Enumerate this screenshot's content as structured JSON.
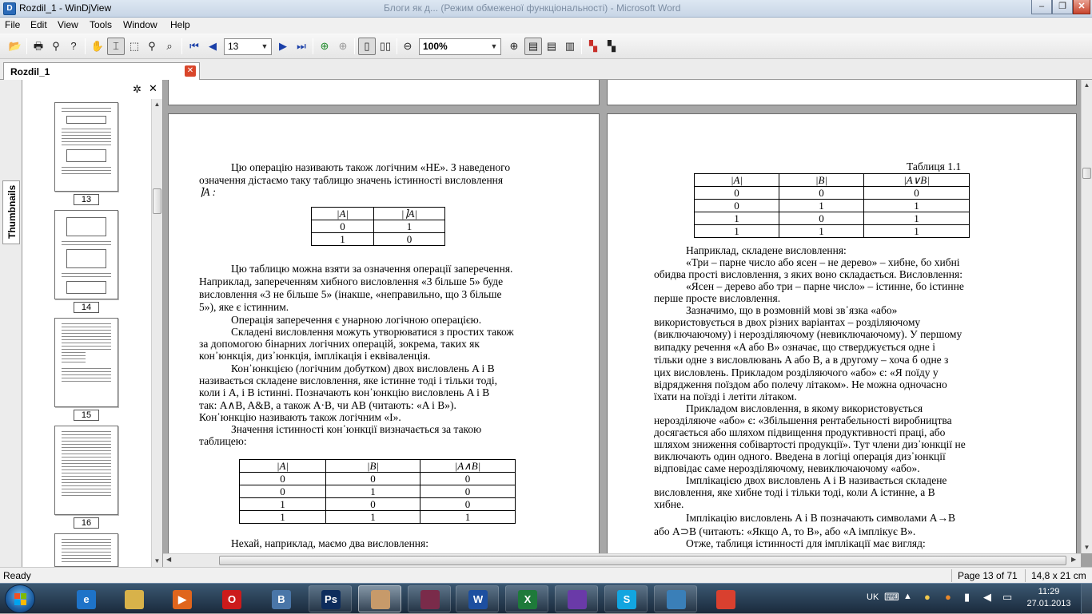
{
  "window": {
    "title": "Rozdil_1 - WinDjView",
    "background_title": "Блоги як д... (Режим обмеженої функціональності) - Microsoft Word",
    "minimize": "–",
    "maximize": "❐",
    "close": "✕"
  },
  "menu": [
    "File",
    "Edit",
    "View",
    "Tools",
    "Window",
    "Help"
  ],
  "toolbar": {
    "page_value": "13",
    "zoom_value": "100%",
    "icons": [
      "open-icon",
      "print-icon",
      "find-icon",
      "help-icon",
      "hand-icon",
      "select-icon",
      "marquee-icon",
      "zoom-icon",
      "zoom-rect-icon",
      "first-page-icon",
      "prev-page-icon",
      "next-page-icon",
      "last-page-icon",
      "back-icon",
      "forward-icon",
      "single-page-icon",
      "two-page-icon",
      "zoom-out-icon",
      "zoom-in-icon",
      "layout-continuous-icon",
      "layout-page-icon",
      "layout-facing-icon",
      "color-icon",
      "bw-icon"
    ]
  },
  "tab": {
    "label": "Rozdil_1",
    "close": "✕"
  },
  "sidebar": {
    "tab_label": "Thumbnails",
    "settings": "✲",
    "close": "✕",
    "thumbnails": [
      {
        "num": "13"
      },
      {
        "num": "14"
      },
      {
        "num": "15"
      },
      {
        "num": "16"
      }
    ]
  },
  "left_page": {
    "lines": [
      "Цю операцію називають також логічним «НЕ». З наведеного",
      "означення дістаємо таку таблицю значень істинності висловлення",
      "⌉A :",
      "Цю таблицю можна взяти за означення операції заперечення.",
      "Наприклад, запереченням хибного висловлення «3 більше 5» буде",
      "висловлення «3 не більше 5» (інакше, «неправильно, що 3 більше",
      "5»), яке є істинним.",
      "Операція заперечення є унарною логічною операцією.",
      "Складені висловлення можуть утворюватися з простих також",
      "за допомогою бінарних логічних операцій, зокрема, таких як",
      "кон᾿юнкція, диз᾿юнкція, імплікація і еквіваленція.",
      "Кон᾿юнкцією (логічним добутком) двох висловлень A і B",
      "називається складене висловлення, яке істинне тоді і тільки тоді,",
      "коли і A, і B істинні. Позначають кон᾿юнкцію висловлень A і B",
      "так: A∧B, A&B, а також A·B, чи AB (читають: «A і B»).",
      "Кон᾿юнкцію називають також логічним «І».",
      "Значення істинності кон᾿юнкції визначається за такою",
      "таблицею:",
      "Нехай, наприклад, маємо два висловлення:"
    ],
    "neg_table": {
      "header": [
        "|A|",
        "|⌉A|"
      ],
      "rows": [
        [
          "0",
          "1"
        ],
        [
          "1",
          "0"
        ]
      ]
    },
    "and_table": {
      "header": [
        "|A|",
        "|B|",
        "|A∧B|"
      ],
      "rows": [
        [
          "0",
          "0",
          "0"
        ],
        [
          "0",
          "1",
          "0"
        ],
        [
          "1",
          "0",
          "0"
        ],
        [
          "1",
          "1",
          "1"
        ]
      ]
    }
  },
  "right_page": {
    "caption": "Таблиця 1.1",
    "or_table": {
      "header": [
        "|A|",
        "|B|",
        "|A∨B|"
      ],
      "rows": [
        [
          "0",
          "0",
          "0"
        ],
        [
          "0",
          "1",
          "1"
        ],
        [
          "1",
          "0",
          "1"
        ],
        [
          "1",
          "1",
          "1"
        ]
      ]
    },
    "lines": [
      "Наприклад, складене висловлення:",
      "«Три – парне число або ясен – не дерево» – хибне, бо хибні",
      "обидва прості висловлення, з яких воно складається. Висловлення:",
      "«Ясен – дерево або три – парне число» – істинне, бо істинне",
      "перше просте висловлення.",
      "Зазначимо, що в розмовній мові зв᾿язка «або»",
      "використовується в двох різних варіантах – розділяючому",
      "(виключаючому) і нерозділяючому (невиключаючому). У першому",
      "випадку речення «A або B» означає, що стверджується одне і",
      "тільки одне з висловлювань A або B, а в другому – хоча б одне з",
      "цих висловлень. Прикладом розділяючого «або» є: «Я поїду у",
      "відрядження поїздом або полечу літаком». Не можна одночасно",
      "їхати на поїзді і летіти літаком.",
      "Прикладом висловлення, в якому використовується",
      "нерозділяюче «або» є: «Збільшення рентабельності виробництва",
      "досягається або шляхом підвищення продуктивності праці, або",
      "шляхом зниження собівартості продукції». Тут члени диз᾿юнкції не",
      "виключають один одного. Введена в логіці операція диз᾿юнкції",
      "відповідає саме нерозділяючому, невиключаючому «або».",
      "Імплікацією двох висловлень A і B називається складене",
      "висловлення, яке хибне тоді і тільки тоді, коли A істинне, а B",
      "хибне.",
      "Імплікацію висловлень A і B позначають символами A→B",
      "або A⊃B (читають: «Якщо A, то B», або «A імплікує B».",
      "Отже, таблиця істинності для імплікації має вигляд:"
    ]
  },
  "status": {
    "left": "Ready",
    "page": "Page 13 of 71",
    "size": "14,8 x 21 cm"
  },
  "taskbar": {
    "apps": [
      {
        "name": "ie",
        "label": "e",
        "color": "#1e73c8"
      },
      {
        "name": "explorer",
        "label": "",
        "color": "#d8b24a"
      },
      {
        "name": "media-player",
        "label": "▶",
        "color": "#e0651c"
      },
      {
        "name": "opera",
        "label": "O",
        "color": "#cc1b1b"
      },
      {
        "name": "vk",
        "label": "B",
        "color": "#4a76a8"
      },
      {
        "name": "photoshop",
        "label": "Ps",
        "color": "#0d2c5c"
      },
      {
        "name": "windjview",
        "label": "",
        "color": "#c79a6a"
      },
      {
        "name": "winrar",
        "label": "",
        "color": "#7a2b4a"
      },
      {
        "name": "word",
        "label": "W",
        "color": "#1d4fa0"
      },
      {
        "name": "excel",
        "label": "X",
        "color": "#1e7a3a"
      },
      {
        "name": "onenote",
        "label": "",
        "color": "#6a3aa8"
      },
      {
        "name": "skype",
        "label": "S",
        "color": "#12a5e0"
      },
      {
        "name": "picture-viewer",
        "label": "",
        "color": "#3a7fb8"
      },
      {
        "name": "chrome",
        "label": "",
        "color": "#d9402f"
      }
    ],
    "lang": "UK",
    "time": "11:29",
    "date": "27.01.2013"
  }
}
